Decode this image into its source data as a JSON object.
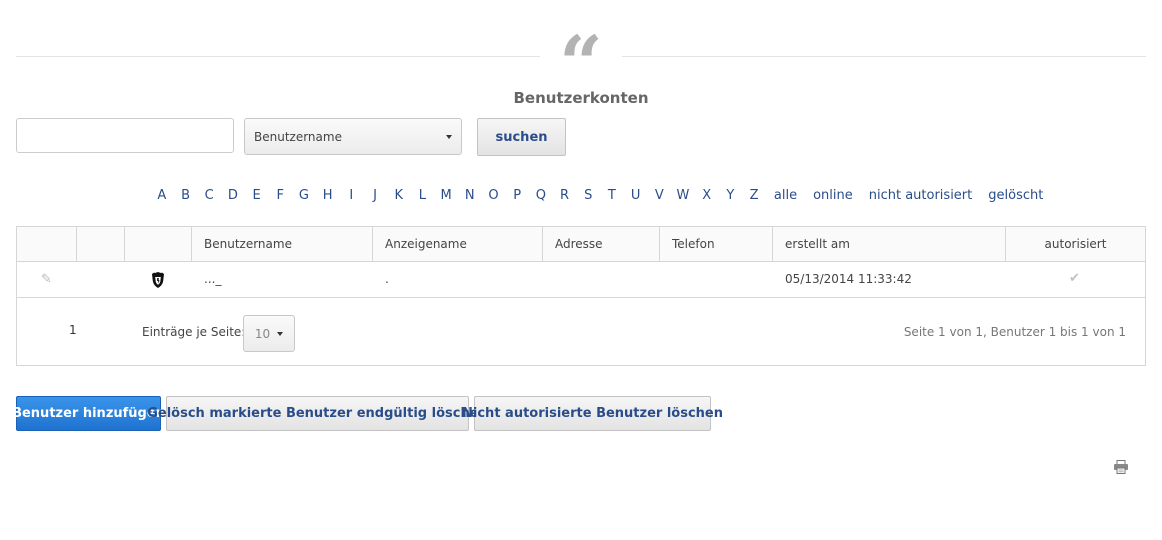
{
  "header": {
    "title": "Benutzerkonten"
  },
  "search": {
    "input_value": "",
    "input_placeholder": "",
    "field_selected": "Benutzername",
    "button_label": "suchen"
  },
  "alphabet_filter": {
    "letters": [
      "A",
      "B",
      "C",
      "D",
      "E",
      "F",
      "G",
      "H",
      "I",
      "J",
      "K",
      "L",
      "M",
      "N",
      "O",
      "P",
      "Q",
      "R",
      "S",
      "T",
      "U",
      "V",
      "W",
      "X",
      "Y",
      "Z"
    ],
    "all_label": "alle",
    "online_label": "online",
    "unauthorized_label": "nicht autorisiert",
    "deleted_label": "gelöscht"
  },
  "table": {
    "columns": {
      "username": "Benutzername",
      "display_name": "Anzeigename",
      "address": "Adresse",
      "phone": "Telefon",
      "created": "erstellt am",
      "authorized": "autorisiert"
    },
    "rows": [
      {
        "username": "..._",
        "display_name": ".",
        "address": "",
        "phone": "",
        "created": "05/13/2014 11:33:42",
        "authorized": true
      }
    ]
  },
  "pager": {
    "current_page": "1",
    "per_page_label": "Einträge je Seite:",
    "per_page_value": "10",
    "summary": "Seite 1 von 1, Benutzer 1 bis 1 von 1"
  },
  "actions": {
    "add_user": "Benutzer hinzufügen",
    "purge_deleted": "Gelösch markierte Benutzer endgültig löschen",
    "delete_unauthorized": "Nicht autorisierte Benutzer löschen"
  },
  "icons": {
    "header": "quote-icon",
    "edit": "pencil-icon",
    "superuser": "shield-icon",
    "authorized": "check-icon",
    "print": "printer-icon"
  },
  "colors": {
    "link": "#2a4d8a",
    "primary_button": "#2a80db"
  }
}
